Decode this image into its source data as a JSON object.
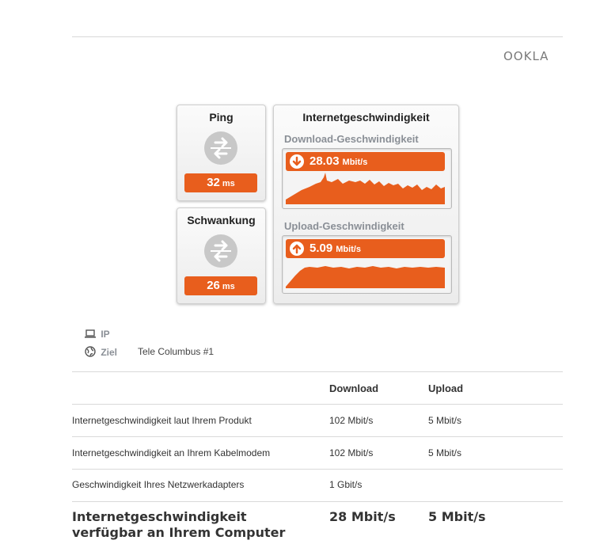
{
  "logo": "OOKLA",
  "ping": {
    "title": "Ping",
    "value": "32",
    "unit": "ms"
  },
  "jitter": {
    "title": "Schwankung",
    "value": "26",
    "unit": "ms"
  },
  "speed": {
    "title": "Internetgeschwindigkeit",
    "download": {
      "label": "Download-Geschwindigkeit",
      "value": "28.03",
      "unit": "Mbit/s"
    },
    "upload": {
      "label": "Upload-Geschwindigkeit",
      "value": "5.09",
      "unit": "Mbit/s"
    }
  },
  "info": {
    "ip_label": "IP",
    "target_label": "Ziel",
    "target_value": "Tele Columbus #1"
  },
  "table": {
    "col_download": "Download",
    "col_upload": "Upload",
    "rows": [
      {
        "label": "Internetgeschwindigkeit laut Ihrem Produkt",
        "download": "102 Mbit/s",
        "upload": "5 Mbit/s"
      },
      {
        "label": "Internetgeschwindigkeit an Ihrem Kabelmodem",
        "download": "102 Mbit/s",
        "upload": "5 Mbit/s"
      },
      {
        "label": "Geschwindigkeit Ihres Netzwerkadapters",
        "download": "1 Gbit/s",
        "upload": ""
      }
    ],
    "total": {
      "label_line1": "Internetgeschwindigkeit",
      "label_line2": "verfügbar an Ihrem Computer",
      "download": "28 Mbit/s",
      "upload": "5 Mbit/s"
    }
  },
  "colors": {
    "accent": "#e85e1d",
    "muted": "#8a8f96"
  }
}
